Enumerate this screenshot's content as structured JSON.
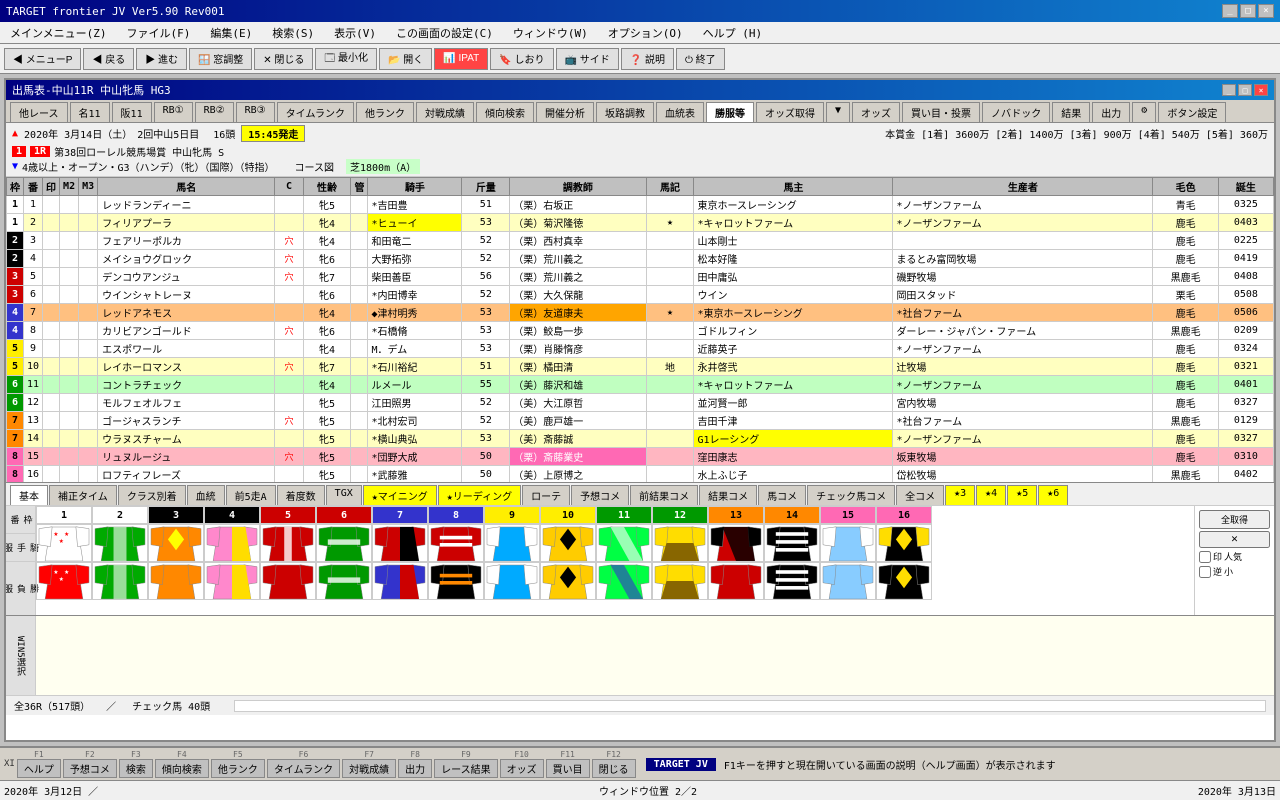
{
  "titleBar": {
    "title": "TARGET frontier JV  Ver5.90  Rev001",
    "buttons": [
      "_",
      "□",
      "×"
    ]
  },
  "menuBar": {
    "items": [
      "メインメニュー(Z)",
      "ファイル(F)",
      "編集(E)",
      "検索(S)",
      "表示(V)",
      "この画面の設定(C)",
      "ウィンドウ(W)",
      "オプション(O)",
      "ヘルプ (H)"
    ]
  },
  "toolbar": {
    "buttons": [
      {
        "label": "◀ メニューP",
        "icon": "menu"
      },
      {
        "label": "◀ 戻る"
      },
      {
        "label": "▶ 進む"
      },
      {
        "label": "🪟 窓調整"
      },
      {
        "label": "✕ 閉じる"
      },
      {
        "label": "📋 最小化"
      },
      {
        "label": "📂 開く"
      },
      {
        "label": "📊 IPAT"
      },
      {
        "label": "🔖 しおり"
      },
      {
        "label": "📺 サイド"
      },
      {
        "label": "❓ 説明"
      },
      {
        "label": "⏻ 終了"
      }
    ]
  },
  "windowTitle": "出馬表-中山11R 中山牝馬 HG3",
  "tabs": [
    {
      "label": "他レース",
      "active": false
    },
    {
      "label": "名11",
      "active": false
    },
    {
      "label": "阪11",
      "active": false
    },
    {
      "label": "RB①",
      "active": false
    },
    {
      "label": "RB②",
      "active": false
    },
    {
      "label": "RB③",
      "active": false
    },
    {
      "label": "タイムランク",
      "active": false
    },
    {
      "label": "他ランク",
      "active": false
    },
    {
      "label": "対戦成績",
      "active": false
    },
    {
      "label": "傾向検索",
      "active": false
    },
    {
      "label": "開催分析",
      "active": false
    },
    {
      "label": "坂路調教",
      "active": false
    },
    {
      "label": "血統表",
      "active": false
    },
    {
      "label": "勝服等",
      "active": true
    },
    {
      "label": "オッズ取得",
      "active": false
    },
    {
      "label": "▼",
      "active": false
    },
    {
      "label": "オッズ",
      "active": false
    },
    {
      "label": "買い目・投票",
      "active": false
    },
    {
      "label": "ノバドック",
      "active": false
    },
    {
      "label": "結果",
      "active": false
    },
    {
      "label": "出力",
      "active": false
    },
    {
      "label": "⚙",
      "active": false
    },
    {
      "label": "ボタン設定",
      "active": false
    }
  ],
  "raceInfo": {
    "date": "2020年 3月14日（土）",
    "round": "2回中山5日目",
    "numHorses": "16頭",
    "time": "15:45発走",
    "raceNum": "11",
    "racePlace": "1R",
    "raceName": "第38回ローレル競馬場賞 中山牝馬 S",
    "prize": "本賞金 [1着] 3600万 [2着] 1400万 [3着] 900万 [4着] 540万 [5着] 360万",
    "conditions": "4歳以上・オープン・G3（ハンデ）（牝）（国際）（特指）",
    "course": "コース図",
    "surface": "芝1800m（A）",
    "badges": [
      "1",
      "1R"
    ]
  },
  "tableHeaders": [
    "枠",
    "番",
    "印",
    "M2",
    "M3",
    "馬名",
    "C",
    "性齢",
    "管",
    "騎手",
    "斤量",
    "調教師",
    "馬記",
    "馬主",
    "生産者",
    "毛色",
    "誕生"
  ],
  "horses": [
    {
      "waku": 1,
      "bango": 1,
      "imp": "",
      "m2": "",
      "m3": "",
      "name": "レッドランディーニ",
      "c": "",
      "seire": "牝5",
      "kan": "",
      "jockey": "*吉田豊",
      "weight": 51,
      "trainer": "（栗）右坂正",
      "umaki": "",
      "owner": "東京ホースレーシング",
      "breeder": "*ノーザンファーム",
      "color": "青毛",
      "birth": "0325",
      "rowColor": "white"
    },
    {
      "waku": 1,
      "bango": 2,
      "imp": "",
      "m2": "",
      "m3": "",
      "name": "フィリアプーラ",
      "c": "",
      "seire": "牝4",
      "kan": "",
      "jockey": "*ヒューイ",
      "weight": 53,
      "trainer": "（美）菊沢隆徳",
      "umaki": "★",
      "owner": "*キャロットファーム",
      "breeder": "*ノーザンファーム",
      "color": "鹿毛",
      "birth": "0403",
      "rowColor": "yellow",
      "jockeyHL": "yellow"
    },
    {
      "waku": 2,
      "bango": 3,
      "imp": "",
      "m2": "",
      "m3": "",
      "name": "フェアリーポルカ",
      "c": "穴",
      "seire": "牝4",
      "kan": "",
      "jockey": "和田竜二",
      "weight": 52,
      "trainer": "（栗）西村真幸",
      "umaki": "",
      "owner": "山本剛士",
      "breeder": "",
      "color": "鹿毛",
      "birth": "0225",
      "rowColor": "white"
    },
    {
      "waku": 2,
      "bango": 4,
      "imp": "",
      "m2": "",
      "m3": "",
      "name": "メイショウグロック",
      "c": "穴",
      "seire": "牝6",
      "kan": "",
      "jockey": "大野拓弥",
      "weight": 52,
      "trainer": "（栗）荒川義之",
      "umaki": "",
      "owner": "松本好隆",
      "breeder": "まるとみ富岡牧場",
      "color": "鹿毛",
      "birth": "0419",
      "rowColor": "white"
    },
    {
      "waku": 3,
      "bango": 5,
      "imp": "",
      "m2": "",
      "m3": "",
      "name": "デンコウアンジュ",
      "c": "穴",
      "seire": "牝7",
      "kan": "",
      "jockey": "柴田善臣",
      "weight": 56,
      "trainer": "（栗）荒川義之",
      "umaki": "",
      "owner": "田中庸弘",
      "breeder": "磯野牧場",
      "color": "黒鹿毛",
      "birth": "0408",
      "rowColor": "white"
    },
    {
      "waku": 3,
      "bango": 6,
      "imp": "",
      "m2": "",
      "m3": "",
      "name": "ウインシャトレーヌ",
      "c": "",
      "seire": "牝6",
      "kan": "",
      "jockey": "*内田博幸",
      "weight": 52,
      "trainer": "（栗）大久保龍",
      "umaki": "",
      "owner": "ウイン",
      "breeder": "岡田スタッド",
      "color": "栗毛",
      "birth": "0508",
      "rowColor": "white"
    },
    {
      "waku": 4,
      "bango": 7,
      "imp": "",
      "m2": "",
      "m3": "",
      "name": "レッドアネモス",
      "c": "",
      "seire": "牝4",
      "kan": "",
      "jockey": "◆津村明秀",
      "weight": 53,
      "trainer": "（栗）友道康夫",
      "umaki": "★",
      "owner": "*東京ホースレーシング",
      "breeder": "*社台ファーム",
      "color": "鹿毛",
      "birth": "0506",
      "rowColor": "orange",
      "trainerHL": "orange"
    },
    {
      "waku": 4,
      "bango": 8,
      "imp": "",
      "m2": "",
      "m3": "",
      "name": "カリビアンゴールド",
      "c": "穴",
      "seire": "牝6",
      "kan": "",
      "jockey": "*石橋脩",
      "weight": 53,
      "trainer": "（栗）鮫島一歩",
      "umaki": "",
      "owner": "ゴドルフィン",
      "breeder": "ダーレー・ジャパン・ファーム",
      "color": "黒鹿毛",
      "birth": "0209",
      "rowColor": "white"
    },
    {
      "waku": 5,
      "bango": 9,
      "imp": "",
      "m2": "",
      "m3": "",
      "name": "エスポワール",
      "c": "",
      "seire": "牝4",
      "kan": "",
      "jockey": "M．デム",
      "weight": 53,
      "trainer": "（栗）肖滕惰彦",
      "umaki": "",
      "owner": "近藤英子",
      "breeder": "*ノーザンファーム",
      "color": "鹿毛",
      "birth": "0324",
      "rowColor": "white"
    },
    {
      "waku": 5,
      "bango": 10,
      "imp": "",
      "m2": "",
      "m3": "",
      "name": "レイホーロマンス",
      "c": "穴",
      "seire": "牝7",
      "kan": "",
      "jockey": "*石川裕紀",
      "weight": 51,
      "trainer": "（栗）橘田清",
      "umaki": "地",
      "owner": "永井啓弐",
      "breeder": "辻牧場",
      "color": "鹿毛",
      "birth": "0321",
      "rowColor": "yellow"
    },
    {
      "waku": 6,
      "bango": 11,
      "imp": "",
      "m2": "",
      "m3": "",
      "name": "コントラチェック",
      "c": "",
      "seire": "牝4",
      "kan": "",
      "jockey": "ルメール",
      "weight": 55,
      "trainer": "（美）藤沢和雄",
      "umaki": "",
      "owner": "*キャロットファーム",
      "breeder": "*ノーザンファーム",
      "color": "鹿毛",
      "birth": "0401",
      "rowColor": "green"
    },
    {
      "waku": 6,
      "bango": 12,
      "imp": "",
      "m2": "",
      "m3": "",
      "name": "モルフェオルフェ",
      "c": "",
      "seire": "牝5",
      "kan": "",
      "jockey": "江田照男",
      "weight": 52,
      "trainer": "（美）大江原哲",
      "umaki": "",
      "owner": "並河賢一郎",
      "breeder": "宮内牧場",
      "color": "鹿毛",
      "birth": "0327",
      "rowColor": "white"
    },
    {
      "waku": 7,
      "bango": 13,
      "imp": "",
      "m2": "",
      "m3": "",
      "name": "ゴージャスランチ",
      "c": "穴",
      "seire": "牝5",
      "kan": "",
      "jockey": "*北村宏司",
      "weight": 52,
      "trainer": "（美）鹿戸雄一",
      "umaki": "",
      "owner": "吉田千津",
      "breeder": "*社台ファーム",
      "color": "黒鹿毛",
      "birth": "0129",
      "rowColor": "white"
    },
    {
      "waku": 7,
      "bango": 14,
      "imp": "",
      "m2": "",
      "m3": "",
      "name": "ウラヌスチャーム",
      "c": "",
      "seire": "牝5",
      "kan": "",
      "jockey": "*横山典弘",
      "weight": 53,
      "trainer": "（美）斎藤誠",
      "umaki": "",
      "owner": "G1レーシング",
      "breeder": "*ノーザンファーム",
      "color": "鹿毛",
      "birth": "0327",
      "rowColor": "yellow",
      "ownerHL": "yellow"
    },
    {
      "waku": 8,
      "bango": 15,
      "imp": "",
      "m2": "",
      "m3": "",
      "name": "リュヌルージュ",
      "c": "穴",
      "seire": "牝5",
      "kan": "",
      "jockey": "*団野大成",
      "weight": 50,
      "trainer": "（栗）斎藤業史",
      "umaki": "",
      "owner": "窪田康志",
      "breeder": "坂東牧場",
      "color": "鹿毛",
      "birth": "0310",
      "rowColor": "pink",
      "trainerHL": "pink"
    },
    {
      "waku": 8,
      "bango": 16,
      "imp": "",
      "m2": "",
      "m3": "",
      "name": "ロフティフレーズ",
      "c": "",
      "seire": "牝5",
      "kan": "",
      "jockey": "*武藤雅",
      "weight": 50,
      "trainer": "（美）上原博之",
      "umaki": "",
      "owner": "水上ふじ子",
      "breeder": "岱松牧場",
      "color": "黒鹿毛",
      "birth": "0402",
      "rowColor": "white"
    }
  ],
  "bottomTabs": [
    {
      "label": "基本",
      "active": true
    },
    {
      "label": "補正タイム"
    },
    {
      "label": "クラス別着"
    },
    {
      "label": "血統"
    },
    {
      "label": "前5走A"
    },
    {
      "label": "着度数"
    },
    {
      "label": "TGX"
    },
    {
      "label": "★マイニング",
      "star": true
    },
    {
      "label": "★リーディング",
      "star": true
    },
    {
      "label": "ローテ"
    },
    {
      "label": "予想コメ"
    },
    {
      "label": "前結果コメ"
    },
    {
      "label": "結果コメ"
    },
    {
      "label": "馬コメ"
    },
    {
      "label": "チェック馬コメ"
    },
    {
      "label": "全コメ"
    },
    {
      "label": "★3",
      "star": true
    },
    {
      "label": "★4",
      "star": true
    },
    {
      "label": "★5",
      "star": true
    },
    {
      "label": "★6",
      "star": true
    }
  ],
  "silks": {
    "numbers": [
      1,
      2,
      3,
      4,
      5,
      6,
      7,
      8,
      9,
      10,
      11,
      12,
      13,
      14,
      15,
      16
    ],
    "colors": [
      {
        "bg": "white",
        "border": "white"
      },
      {
        "bg": "#90EE90",
        "border": "#90EE90"
      },
      {
        "bg": "#FFA500",
        "border": "#FFA500"
      },
      {
        "bg": "#FFD700",
        "border": "#FFD700"
      },
      {
        "bg": "#FF0000",
        "border": "#FF0000"
      },
      {
        "bg": "#FF6347",
        "border": "#FF6347"
      },
      {
        "bg": "#32CD32",
        "border": "#32CD32"
      },
      {
        "bg": "#FF0000",
        "border": "#FF0000"
      },
      {
        "bg": "#00BFFF",
        "border": "#00BFFF"
      },
      {
        "bg": "#FFD700",
        "border": "#FFD700"
      },
      {
        "bg": "#00FF00",
        "border": "#00FF00"
      },
      {
        "bg": "#FFD700",
        "border": "#FFD700"
      },
      {
        "bg": "#FF0000",
        "border": "#FF0000"
      },
      {
        "bg": "black",
        "border": "black"
      },
      {
        "bg": "#87CEEB",
        "border": "#87CEEB"
      },
      {
        "bg": "#FFD700",
        "border": "#FFD700"
      }
    ]
  },
  "bottomInfo": {
    "total": "全36R（517頭）",
    "check": "チェック馬 40頭"
  },
  "functionKeys": [
    {
      "key": "XI",
      "label": ""
    },
    {
      "key": "F1",
      "label": "ヘルプ"
    },
    {
      "key": "F2",
      "label": "予想コメ"
    },
    {
      "key": "F3",
      "label": "検索"
    },
    {
      "key": "F4",
      "label": "傾向検索"
    },
    {
      "key": "F5",
      "label": "他ランク"
    },
    {
      "key": "F6",
      "label": "タイムランク"
    },
    {
      "key": "F7",
      "label": "対戦成績"
    },
    {
      "key": "F8",
      "label": "出力"
    },
    {
      "key": "F9",
      "label": "レース結果"
    },
    {
      "key": "F10",
      "label": "オッズ"
    },
    {
      "key": "F11",
      "label": "買い目"
    },
    {
      "key": "F12",
      "label": "閉じる"
    }
  ],
  "fkeyInfo": "F1キーを押すと現在開いている画面の説明（ヘルプ画面）が表示されます",
  "statusBar": {
    "left": "2020年 3月12日 ／",
    "center": "ウィンドウ位置 2／2",
    "right": "2020年 3月13日"
  },
  "targetLabel": "TARGET JV"
}
